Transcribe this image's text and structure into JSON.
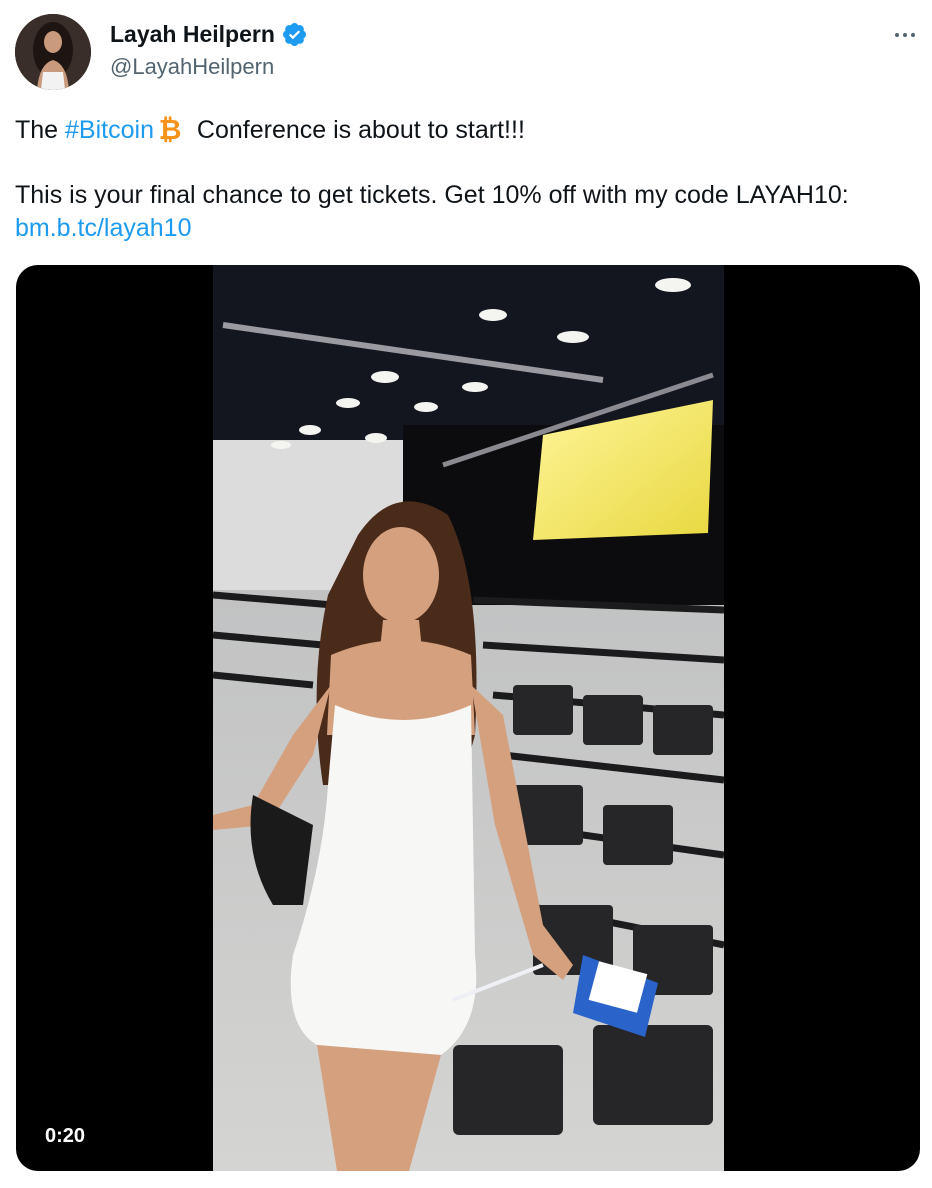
{
  "author": {
    "display_name": "Layah Heilpern",
    "handle": "@LayahHeilpern",
    "verified": true,
    "avatar_icon": "profile-photo"
  },
  "tweet": {
    "line1_prefix": "The ",
    "hashtag": "#Bitcoin",
    "emoji_icon": "bitcoin-icon",
    "line1_suffix": " Conference is about to start!!!",
    "line2": "This is your final chance to get tickets. Get 10% off with my code LAYAH10: ",
    "link_text": "bm.b.tc/layah10"
  },
  "media": {
    "duration": "0:20"
  },
  "colors": {
    "link": "#1d9bf0",
    "verified": "#1d9bf0",
    "bitcoin": "#f7931a",
    "secondary_text": "#536471"
  }
}
